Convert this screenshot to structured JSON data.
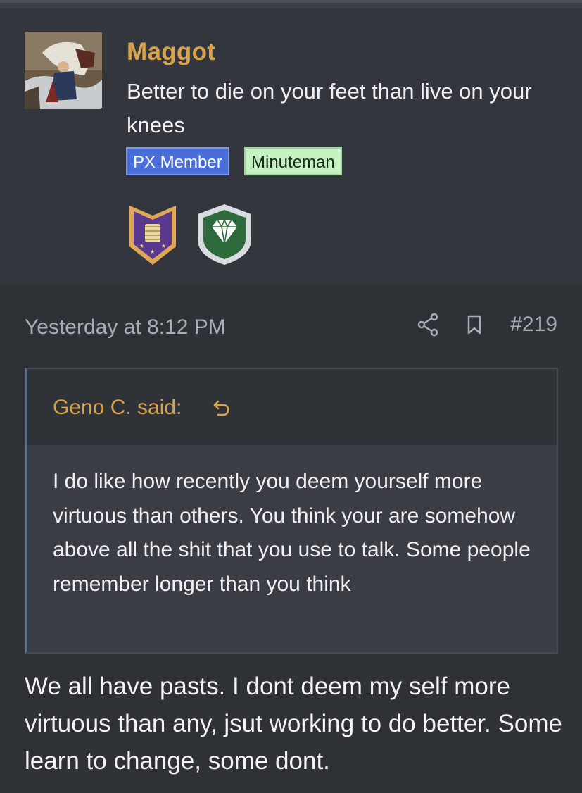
{
  "user": {
    "name": "Maggot",
    "title": "Better to die on your feet than live on your knees",
    "banners": [
      "PX Member",
      "Minuteman"
    ],
    "trophies": [
      "armor-vest-shield-icon",
      "diamond-shield-icon"
    ]
  },
  "post": {
    "date": "Yesterday at 8:12 PM",
    "number": "#219",
    "quote": {
      "author_label": "Geno C. said:",
      "text": "I do like how recently you deem yourself more virtuous than others. You think your are somehow above all the shit that you use to talk. Some people remember longer than you think"
    },
    "message": "We all have pasts. I dont deem my self more virtuous than any, jsut working to do better. Some learn to change, some dont."
  },
  "colors": {
    "username": "#d9a34a",
    "banner_px": "#4a6ed8",
    "banner_minuteman": "#c5f2c2",
    "quote_border": "#5b6f8c"
  }
}
